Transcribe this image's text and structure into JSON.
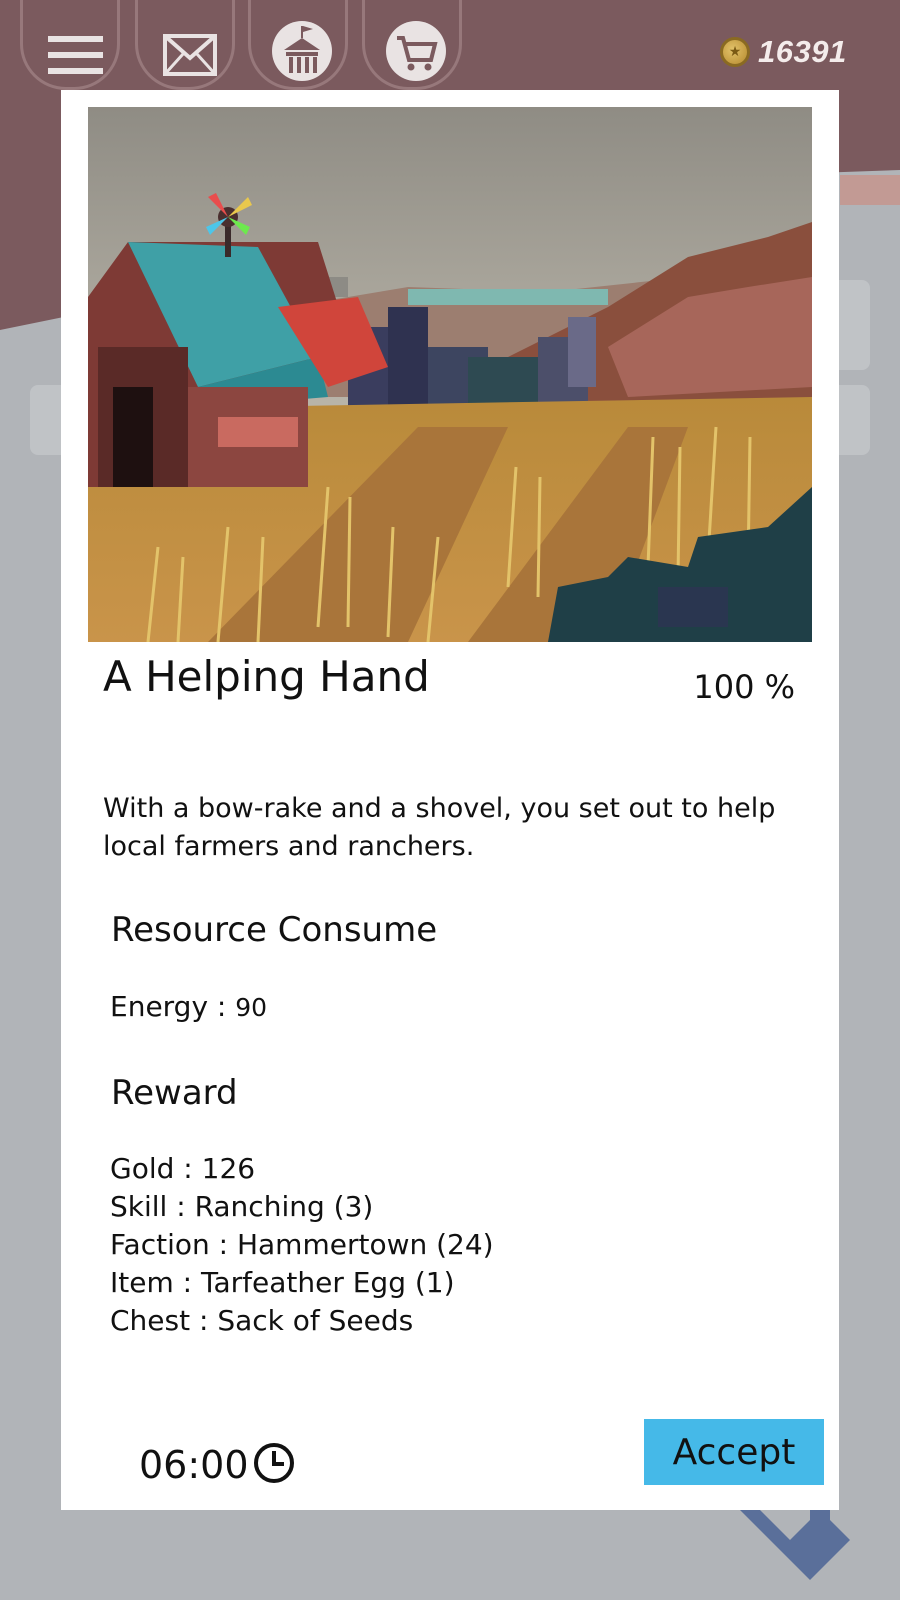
{
  "header": {
    "menu_icon": "hamburger-menu-icon",
    "mail_icon": "envelope-icon",
    "townhall_icon": "town-hall-icon",
    "shop_icon": "shopping-cart-icon",
    "coin_icon": "gold-coin-icon",
    "gold_amount": "16391"
  },
  "quest": {
    "title": "A Helping Hand",
    "success_chance": "100 %",
    "description": "With a bow-rake and a shovel, you set out to help local farmers and ranchers.",
    "consume": {
      "heading": "Resource Consume",
      "items": [
        {
          "label": "Energy : ",
          "value": "90"
        }
      ]
    },
    "reward": {
      "heading": "Reward",
      "items": [
        {
          "label": "Gold : ",
          "value": "126"
        },
        {
          "label": "Skill : ",
          "value": "Ranching (3)"
        },
        {
          "label": "Faction : ",
          "value": "Hammertown (24)"
        },
        {
          "label": "Item : ",
          "value": "Tarfeather Egg (1)"
        },
        {
          "label": "Chest : ",
          "value": "Sack of Seeds"
        }
      ]
    },
    "duration": "06:00",
    "clock_icon": "clock-icon",
    "accept_label": "Accept"
  },
  "colors": {
    "header_bg": "#7b5a5e",
    "page_bg": "#b1b4b8",
    "accept_button": "#45b9e8",
    "arrow": "#5a6f9a"
  }
}
